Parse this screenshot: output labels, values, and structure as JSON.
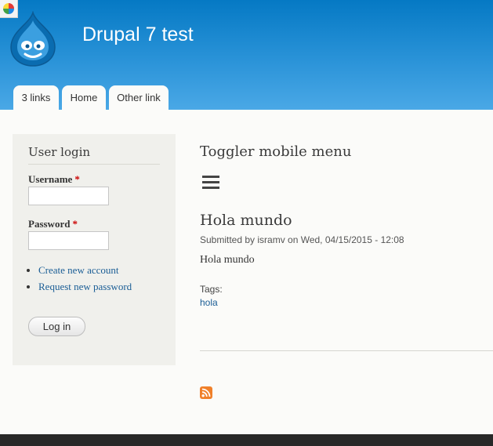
{
  "site": {
    "name": "Drupal 7 test"
  },
  "tabs": [
    "3 links",
    "Home",
    "Other link"
  ],
  "login": {
    "title": "User login",
    "username_label": "Username",
    "password_label": "Password",
    "required_marker": "*",
    "username_value": "",
    "password_value": "",
    "links": [
      "Create new account",
      "Request new password"
    ],
    "button_label": "Log in"
  },
  "content": {
    "block_title": "Toggler mobile menu",
    "node_title": "Hola mundo",
    "submitted": "Submitted by isramv on Wed, 04/15/2015 - 12:08",
    "body": "Hola mundo",
    "tags_label": "Tags:",
    "tag": "hola"
  },
  "icons": {
    "corner": "browser-extension-icon",
    "logo": "drupal-drop-logo",
    "menu": "hamburger-menu-icon",
    "feed": "rss-icon"
  },
  "colors": {
    "header_top": "#0579c4",
    "header_bottom": "#4aa8e6",
    "link": "#1a5d95",
    "required": "#cc0000",
    "rss": "#f0802a",
    "footer": "#282828"
  }
}
